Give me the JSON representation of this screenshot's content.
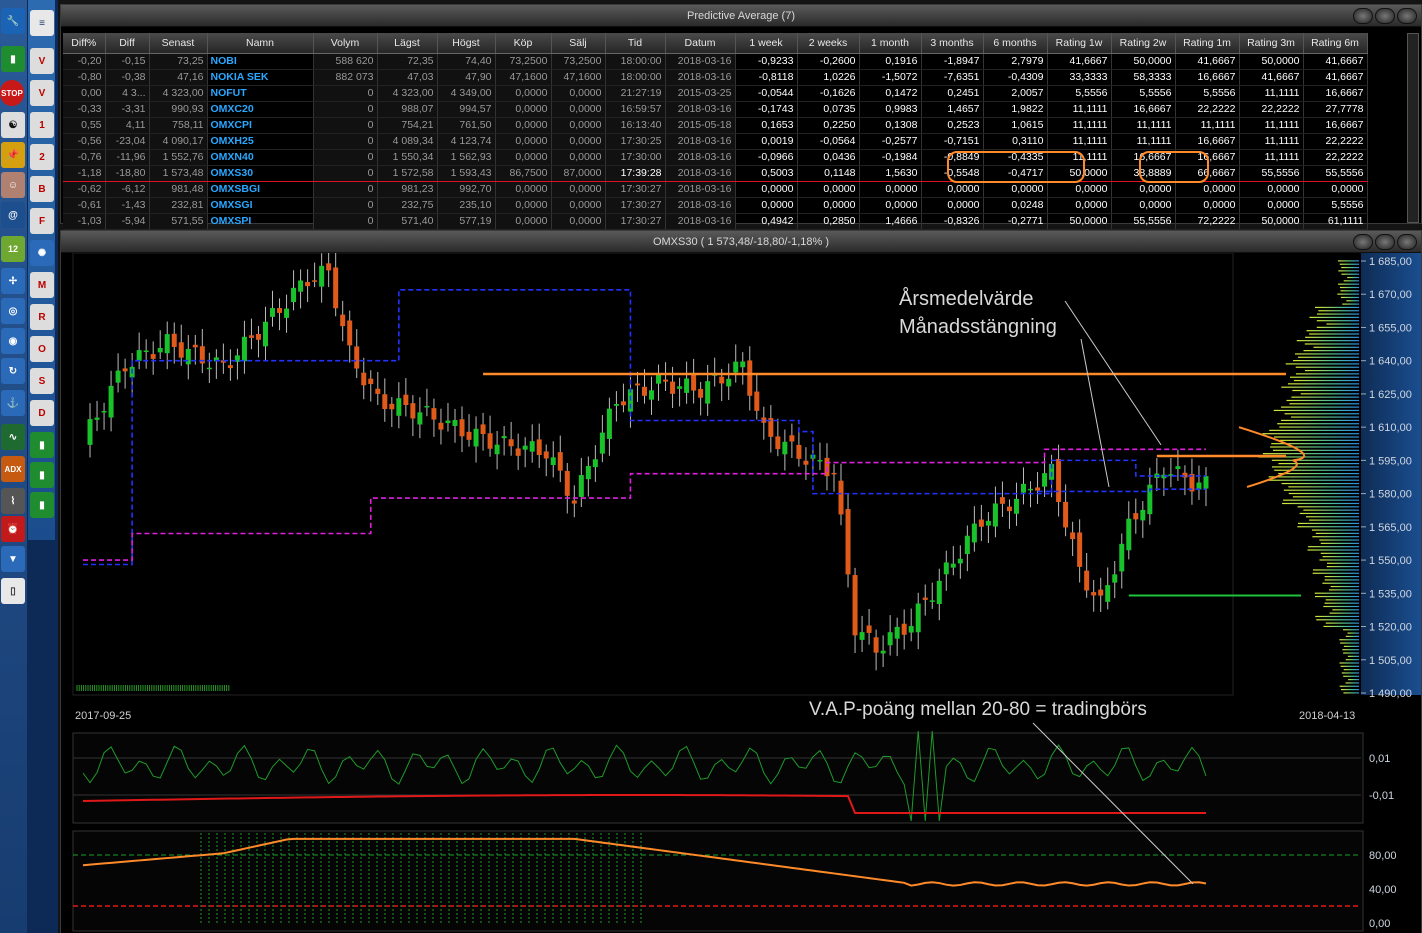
{
  "table": {
    "title": "Predictive Average (7)",
    "columns": [
      "Diff%",
      "Diff",
      "Senast",
      "Namn",
      "Volym",
      "Lägst",
      "Högst",
      "Köp",
      "Sälj",
      "Tid",
      "Datum",
      "1 week",
      "2 weeks",
      "1 month",
      "3 months",
      "6 months",
      "Rating 1w",
      "Rating 2w",
      "Rating 1m",
      "Rating 3m",
      "Rating 6m"
    ],
    "rows": [
      [
        "-0,20",
        "-0,15",
        "73,25",
        "NOBI",
        "588 620",
        "72,35",
        "74,40",
        "73,2500",
        "73,2500",
        "18:00:00",
        "2018-03-16",
        "-0,9233",
        "-0,2600",
        "0,1916",
        "-1,8947",
        "2,7979",
        "41,6667",
        "50,0000",
        "41,6667",
        "50,0000",
        "41,6667"
      ],
      [
        "-0,80",
        "-0,38",
        "47,16",
        "NOKIA SEK",
        "882 073",
        "47,03",
        "47,90",
        "47,1600",
        "47,1600",
        "18:00:00",
        "2018-03-16",
        "-0,8118",
        "1,0226",
        "-1,5072",
        "-7,6351",
        "-0,4309",
        "33,3333",
        "58,3333",
        "16,6667",
        "41,6667",
        "41,6667"
      ],
      [
        "0,00",
        "4 3...",
        "4 323,00",
        "NOFUT",
        "0",
        "4 323,00",
        "4 349,00",
        "0,0000",
        "0,0000",
        "21:27:19",
        "2015-03-25",
        "-0,0544",
        "-0,1626",
        "0,1472",
        "0,2451",
        "2,0057",
        "5,5556",
        "5,5556",
        "5,5556",
        "11,1111",
        "16,6667"
      ],
      [
        "-0,33",
        "-3,31",
        "990,93",
        "OMXC20",
        "0",
        "988,07",
        "994,57",
        "0,0000",
        "0,0000",
        "16:59:57",
        "2018-03-16",
        "-0,1743",
        "0,0735",
        "0,9983",
        "1,4657",
        "1,9822",
        "11,1111",
        "16,6667",
        "22,2222",
        "22,2222",
        "27,7778"
      ],
      [
        "0,55",
        "4,11",
        "758,11",
        "OMXCPI",
        "0",
        "754,21",
        "761,50",
        "0,0000",
        "0,0000",
        "16:13:40",
        "2015-05-18",
        "0,1653",
        "0,2250",
        "0,1308",
        "0,2523",
        "1,0615",
        "11,1111",
        "11,1111",
        "11,1111",
        "11,1111",
        "16,6667"
      ],
      [
        "-0,56",
        "-23,04",
        "4 090,17",
        "OMXH25",
        "0",
        "4 089,34",
        "4 123,74",
        "0,0000",
        "0,0000",
        "17:30:25",
        "2018-03-16",
        "0,0019",
        "-0,0564",
        "-0,2577",
        "-0,7151",
        "0,3110",
        "11,1111",
        "11,1111",
        "16,6667",
        "11,1111",
        "22,2222"
      ],
      [
        "-0,76",
        "-11,96",
        "1 552,76",
        "OMXN40",
        "0",
        "1 550,34",
        "1 562,93",
        "0,0000",
        "0,0000",
        "17:30:00",
        "2018-03-16",
        "-0,0966",
        "0,0436",
        "-0,1984",
        "-0,8849",
        "-0,4335",
        "11,1111",
        "16,6667",
        "16,6667",
        "11,1111",
        "22,2222"
      ],
      [
        "-1,18",
        "-18,80",
        "1 573,48",
        "OMXS30",
        "0",
        "1 572,58",
        "1 593,43",
        "86,7500",
        "87,0000",
        "17:39:28",
        "2018-03-16",
        "0,5003",
        "0,1148",
        "1,5630",
        "-0,5548",
        "-0,4717",
        "50,0000",
        "38,8889",
        "66,6667",
        "55,5556",
        "55,5556"
      ],
      [
        "-0,62",
        "-6,12",
        "981,48",
        "OMXSBGI",
        "0",
        "981,23",
        "992,70",
        "0,0000",
        "0,0000",
        "17:30:27",
        "2018-03-16",
        "0,0000",
        "0,0000",
        "0,0000",
        "0,0000",
        "0,0000",
        "0,0000",
        "0,0000",
        "0,0000",
        "0,0000",
        "0,0000"
      ],
      [
        "-0,61",
        "-1,43",
        "232,81",
        "OMXSGI",
        "0",
        "232,75",
        "235,10",
        "0,0000",
        "0,0000",
        "17:30:27",
        "2018-03-16",
        "0,0000",
        "0,0000",
        "0,0000",
        "0,0000",
        "0,0248",
        "0,0000",
        "0,0000",
        "0,0000",
        "0,0000",
        "5,5556"
      ],
      [
        "-1,03",
        "-5,94",
        "571,55",
        "OMXSPI",
        "0",
        "571,40",
        "577,19",
        "0,0000",
        "0,0000",
        "17:30:27",
        "2018-03-16",
        "0,4942",
        "0,2850",
        "1,4666",
        "-0,8326",
        "-0,2771",
        "50,0000",
        "55,5556",
        "72,2222",
        "50,0000",
        "61,1111"
      ]
    ]
  },
  "chart": {
    "title": "OMXS30 ( 1 573,48/-18,80/-1,18% )",
    "start_date": "2017-09-25",
    "end_date": "2018-04-13",
    "annotation1": "Årsmedelvärde",
    "annotation2": "Månadsstängning",
    "annotation3": "V.A.P-poäng mellan 20-80 = tradingbörs",
    "price_ticks": [
      "1 685,00",
      "1 670,00",
      "1 655,00",
      "1 640,00",
      "1 625,00",
      "1 610,00",
      "1 595,00",
      "1 580,00",
      "1 565,00",
      "1 550,00",
      "1 535,00",
      "1 520,00",
      "1 505,00",
      "1 490,00"
    ],
    "ind1_ticks": [
      "0,01",
      "-0,01"
    ],
    "ind2_ticks": [
      "80,00",
      "40,00",
      "0,00"
    ],
    "colors": {
      "up": "#19c22a",
      "down": "#e05a1a",
      "blue": "#2233ff",
      "magenta": "#e020e0",
      "orange": "#ff8a2a",
      "green_line": "#1fc23a"
    }
  }
}
